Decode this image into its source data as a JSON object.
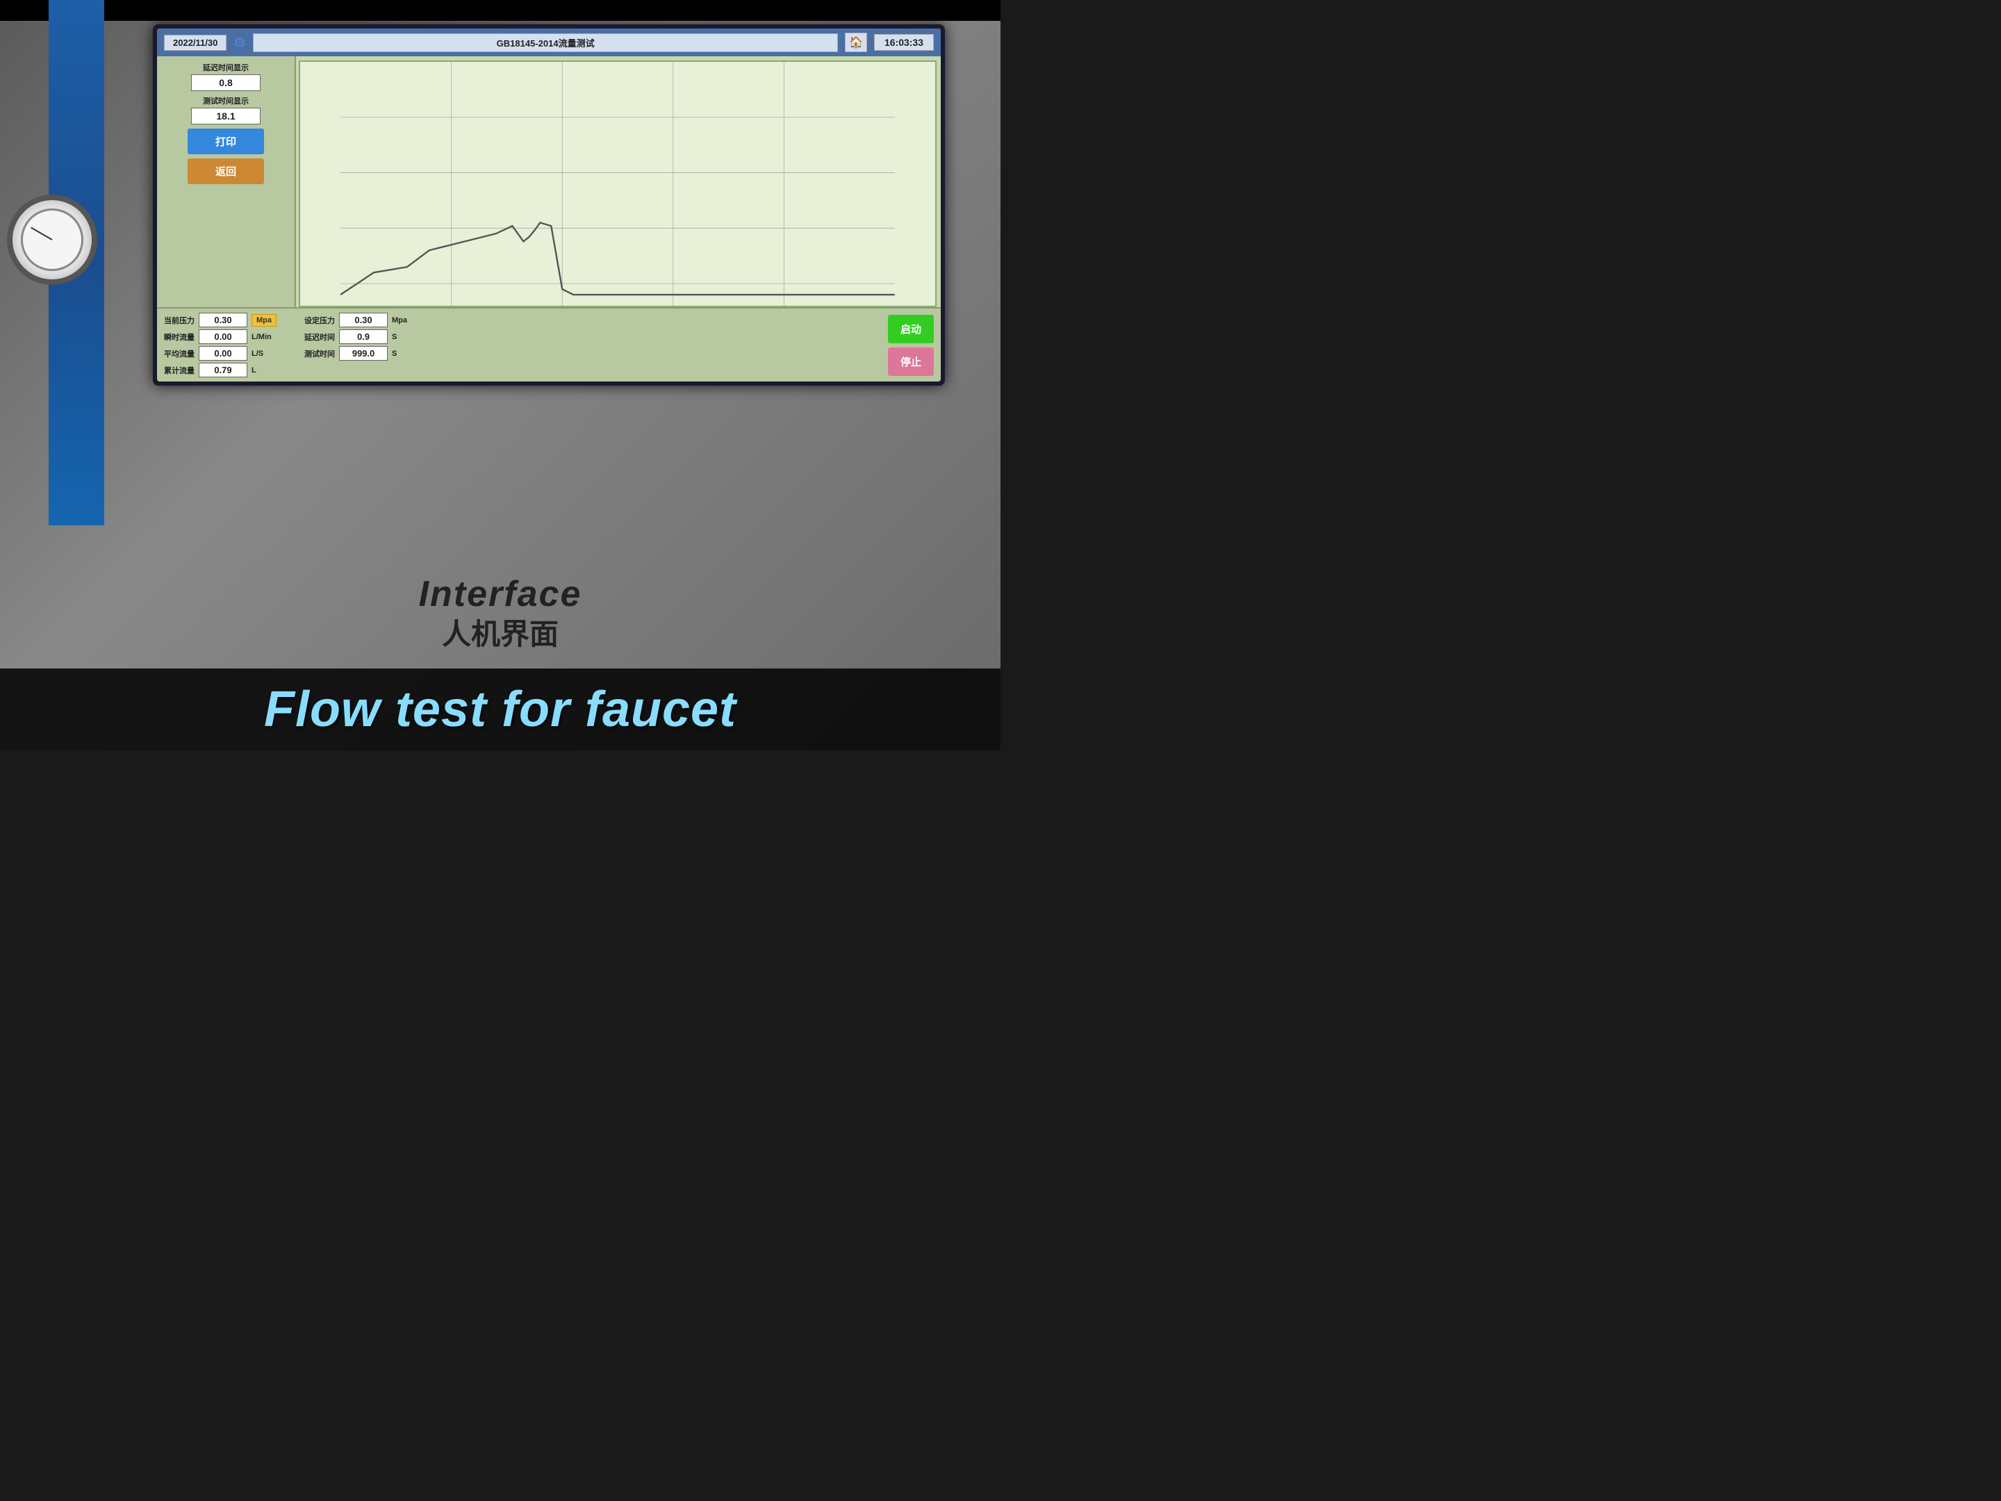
{
  "header": {
    "date": "2022/11/30",
    "title": "GB18145-2014流量测试",
    "time": "16:03:33",
    "gear_icon": "⚙",
    "home_icon": "🏠"
  },
  "left_panel": {
    "delay_label": "延迟时间显示",
    "delay_value": "0.8",
    "test_time_label": "测试时间显示",
    "test_time_value": "18.1",
    "print_btn": "打印",
    "back_btn": "返回"
  },
  "current_data": {
    "pressure_label": "当前压力",
    "pressure_value": "0.30",
    "pressure_unit": "Mpa",
    "instant_flow_label": "瞬时流量",
    "instant_flow_value": "0.00",
    "instant_flow_unit": "L/Min",
    "avg_flow_label": "平均流量",
    "avg_flow_value": "0.00",
    "avg_flow_unit": "L/S",
    "cumulative_flow_label": "累计流量",
    "cumulative_flow_value": "0.79",
    "cumulative_flow_unit": "L"
  },
  "set_data": {
    "set_pressure_label": "设定压力",
    "set_pressure_value": "0.30",
    "set_pressure_unit": "Mpa",
    "delay_label": "延迟时间",
    "delay_value": "0.9",
    "delay_unit": "S",
    "test_time_label": "测试时间",
    "test_time_value": "999.0",
    "test_time_unit": "S"
  },
  "buttons": {
    "start": "启动",
    "stop": "停止"
  },
  "machine_labels": {
    "interface_en": "Interface",
    "interface_cn": "人机界面"
  },
  "video_title": {
    "text": "Flow test for faucet"
  }
}
